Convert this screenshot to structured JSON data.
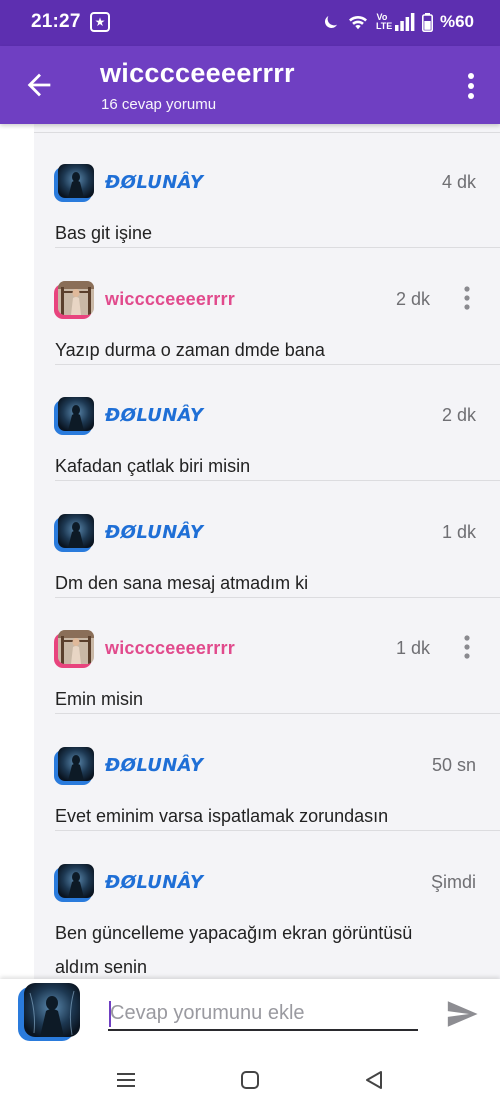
{
  "status_bar": {
    "time": "21:27",
    "notification_glyph": "★",
    "volte_top": "Vo",
    "volte_bottom": "LTE",
    "battery": "%60"
  },
  "app_bar": {
    "title": "wicccceeeerrrr",
    "subtitle": "16 cevap yorumu"
  },
  "comments": [
    {
      "author": "ĐØLUNÂY",
      "author_style": "blue",
      "time": "4 dk",
      "text": "Bas git işine",
      "has_menu": false
    },
    {
      "author": "wicccceeeerrrr",
      "author_style": "pink",
      "time": "2 dk",
      "text": "Yazıp durma o zaman dmde bana",
      "has_menu": true
    },
    {
      "author": "ĐØLUNÂY",
      "author_style": "blue",
      "time": "2 dk",
      "text": "Kafadan çatlak biri misin",
      "has_menu": false
    },
    {
      "author": "ĐØLUNÂY",
      "author_style": "blue",
      "time": "1 dk",
      "text": "Dm den sana mesaj atmadım ki",
      "has_menu": false
    },
    {
      "author": "wicccceeeerrrr",
      "author_style": "pink",
      "time": "1 dk",
      "text": "Emin misin",
      "has_menu": true
    },
    {
      "author": "ĐØLUNÂY",
      "author_style": "blue",
      "time": "50 sn",
      "text": "Evet eminim varsa ispatlamak zorundasın",
      "has_menu": false
    },
    {
      "author": "ĐØLUNÂY",
      "author_style": "blue",
      "time": "Şimdi",
      "text": "Ben güncelleme yapacağım ekran görüntüsü aldım senin",
      "has_menu": false
    }
  ],
  "compose": {
    "placeholder": "Cevap yorumunu ekle"
  },
  "colors": {
    "status_bar": "#5d2fb0",
    "app_bar": "#6f3fc2",
    "author_blue": "#1f6fd6",
    "author_pink": "#e14a8c",
    "ring_blue": "#2a7bdc",
    "ring_pink": "#e8447e"
  },
  "icons": {
    "back": "arrow-left-icon",
    "more": "more-vertical-icon",
    "send": "send-icon",
    "nav_recents": "menu-lines-icon",
    "nav_home": "square-icon",
    "nav_back": "triangle-back-icon"
  }
}
